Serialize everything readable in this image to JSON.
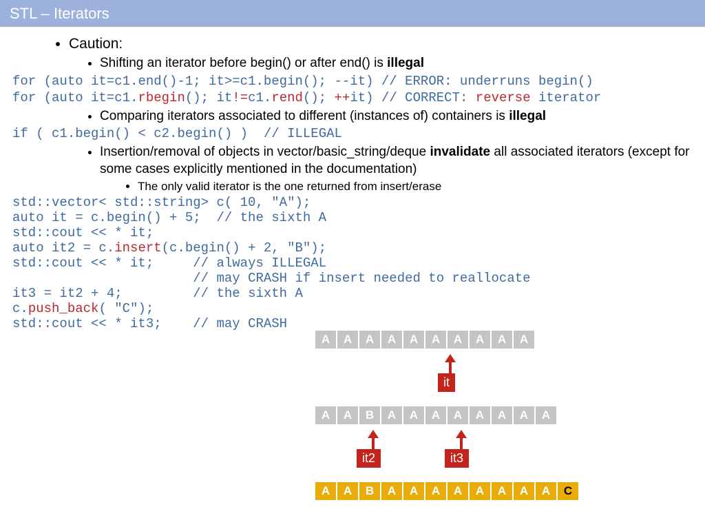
{
  "title": "STL – Iterators",
  "bullet1": "Caution:",
  "bullet2a_pre": "Shifting an iterator before begin() or after end() is ",
  "bullet2a_bold": "illegal",
  "code1_tokens": [
    {
      "t": "for ",
      "c": "c-kw"
    },
    {
      "t": "(",
      "c": "c-kw"
    },
    {
      "t": "auto ",
      "c": "c-kw"
    },
    {
      "t": "it=c1.end()-1; it>=c1.begin(); --it) ",
      "c": "c-kw"
    },
    {
      "t": "// ERROR: underruns begin()",
      "c": "c-cmt"
    }
  ],
  "code2_tokens": [
    {
      "t": "for ",
      "c": "c-kw"
    },
    {
      "t": "(",
      "c": "c-kw"
    },
    {
      "t": "auto ",
      "c": "c-kw"
    },
    {
      "t": "it=c1.",
      "c": "c-kw"
    },
    {
      "t": "rbegin",
      "c": "c-red"
    },
    {
      "t": "(); it",
      "c": "c-kw"
    },
    {
      "t": "!=",
      "c": "c-red"
    },
    {
      "t": "c1.",
      "c": "c-kw"
    },
    {
      "t": "rend",
      "c": "c-red"
    },
    {
      "t": "(); ",
      "c": "c-kw"
    },
    {
      "t": "++",
      "c": "c-red"
    },
    {
      "t": "it) ",
      "c": "c-kw"
    },
    {
      "t": "// CORRECT: ",
      "c": "c-cmt"
    },
    {
      "t": "reverse",
      "c": "c-red"
    },
    {
      "t": " iterator",
      "c": "c-cmt"
    }
  ],
  "bullet2b_pre": "Comparing iterators associated to different (instances of) containers is ",
  "bullet2b_bold": "illegal",
  "code3_tokens": [
    {
      "t": "if ",
      "c": "c-kw"
    },
    {
      "t": "( c1.begin() < c2.begin() )  ",
      "c": "c-kw"
    },
    {
      "t": "// ILLEGAL",
      "c": "c-cmt"
    }
  ],
  "bullet2c_pre": "Insertion/removal of objects in vector/basic_string/deque ",
  "bullet2c_bold": "invalidate",
  "bullet2c_post": " all associated iterators (except for some cases explicitly mentioned in the documentation)",
  "bullet3a": "The only valid iterator is the one returned from insert/erase",
  "code4_lines": [
    [
      {
        "t": "std::vector< std::string> c( 10, \"A\");",
        "c": "c-kw"
      }
    ],
    [
      {
        "t": "auto it = c.begin() + 5;  ",
        "c": "c-kw"
      },
      {
        "t": "// the sixth A",
        "c": "c-cmt"
      }
    ],
    [
      {
        "t": "std::cout << * it;",
        "c": "c-kw"
      }
    ],
    [
      {
        "t": "auto it2 = c.",
        "c": "c-kw"
      },
      {
        "t": "insert",
        "c": "c-red"
      },
      {
        "t": "(c.begin() + 2, \"B\");",
        "c": "c-kw"
      }
    ],
    [
      {
        "t": "std::cout << * it;     ",
        "c": "c-kw"
      },
      {
        "t": "// always ILLEGAL",
        "c": "c-cmt"
      }
    ],
    [
      {
        "t": "                       ",
        "c": "c-kw"
      },
      {
        "t": "// may CRASH if insert needed to reallocate",
        "c": "c-cmt"
      }
    ],
    [
      {
        "t": "it3 = it2 + 4;         ",
        "c": "c-kw"
      },
      {
        "t": "// the sixth A",
        "c": "c-cmt"
      }
    ],
    [
      {
        "t": "c.",
        "c": "c-kw"
      },
      {
        "t": "push_back",
        "c": "c-red"
      },
      {
        "t": "( \"C\");",
        "c": "c-kw"
      }
    ],
    [
      {
        "t": "std::cout << * it3;    ",
        "c": "c-kw"
      },
      {
        "t": "// may CRASH",
        "c": "c-cmt"
      }
    ]
  ],
  "diagram": {
    "row1": [
      "A",
      "A",
      "A",
      "A",
      "A",
      "A",
      "A",
      "A",
      "A",
      "A"
    ],
    "row2": [
      "A",
      "A",
      "B",
      "A",
      "A",
      "A",
      "A",
      "A",
      "A",
      "A",
      "A"
    ],
    "row3": [
      "A",
      "A",
      "B",
      "A",
      "A",
      "A",
      "A",
      "A",
      "A",
      "A",
      "A",
      "C"
    ],
    "label_it": "it",
    "label_it2": "it2",
    "label_it3": "it3"
  }
}
